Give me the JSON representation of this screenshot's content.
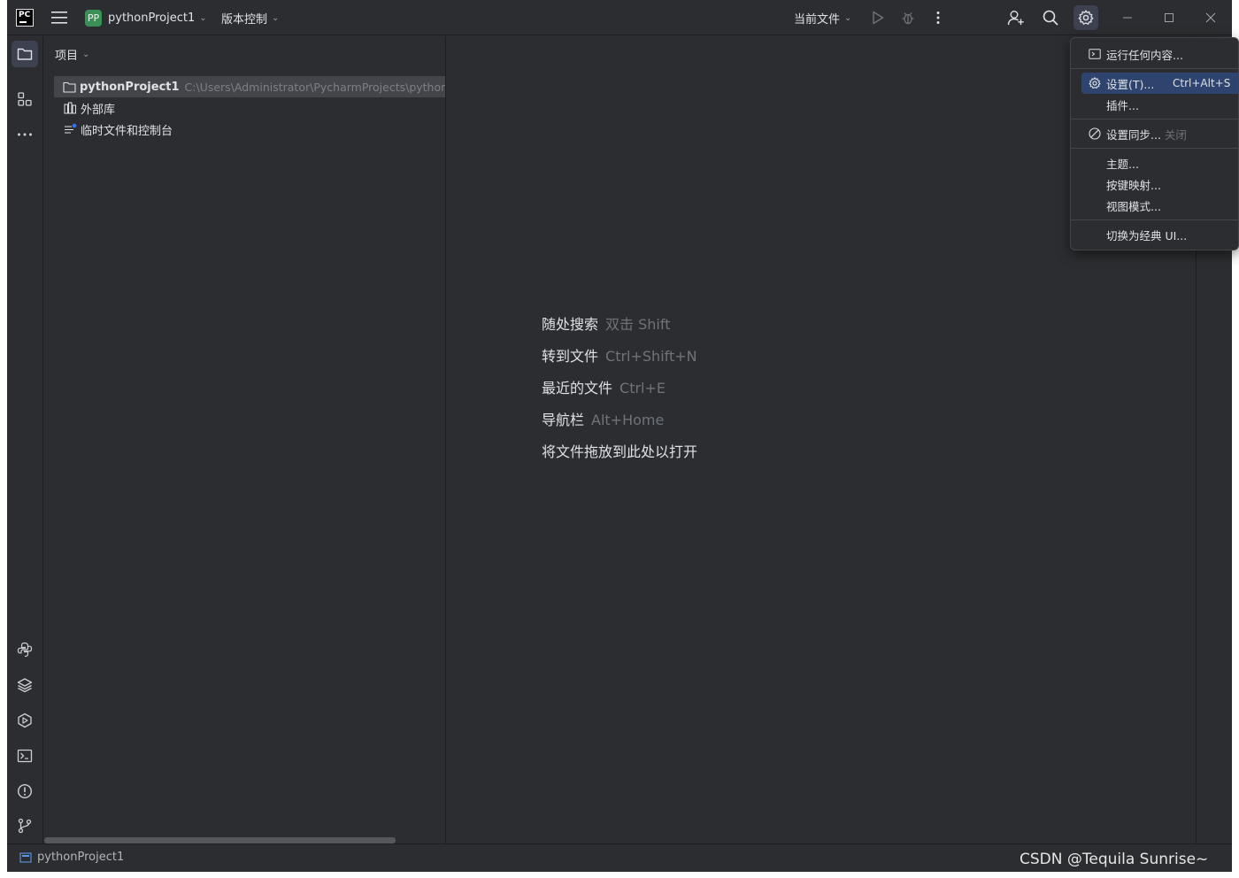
{
  "titlebar": {
    "logo": "PC",
    "project_badge": "PP",
    "project_name": "pythonProject1",
    "vcs_label": "版本控制",
    "run_config": "当前文件"
  },
  "project_panel": {
    "header": "项目",
    "tree": [
      {
        "label": "pythonProject1",
        "path": "C:\\Users\\Administrator\\PycharmProjects\\python",
        "icon": "folder-icon"
      },
      {
        "label": "外部库",
        "icon": "library-icon"
      },
      {
        "label": "临时文件和控制台",
        "icon": "scratch-icon"
      }
    ]
  },
  "editor_hints": [
    {
      "label": "随处搜索",
      "shortcut": "双击 Shift"
    },
    {
      "label": "转到文件",
      "shortcut": "Ctrl+Shift+N"
    },
    {
      "label": "最近的文件",
      "shortcut": "Ctrl+E"
    },
    {
      "label": "导航栏",
      "shortcut": "Alt+Home"
    },
    {
      "label": "将文件拖放到此处以打开",
      "shortcut": ""
    }
  ],
  "settings_menu": {
    "items": [
      {
        "label": "运行任何内容...",
        "icon": "run-anything-icon"
      },
      {
        "label": "设置(T)...",
        "shortcut": "Ctrl+Alt+S",
        "icon": "gear-icon",
        "highlighted": true
      },
      {
        "label": "插件..."
      },
      {
        "label": "设置同步...",
        "suffix": "关闭",
        "icon": "sync-off-icon"
      },
      {
        "label": "主题..."
      },
      {
        "label": "按键映射..."
      },
      {
        "label": "视图模式..."
      },
      {
        "label": "切换为经典 UI..."
      }
    ]
  },
  "statusbar": {
    "project": "pythonProject1"
  },
  "watermark": "CSDN @Tequila Sunrise~",
  "colors": {
    "bg": "#2b2d30",
    "highlight": "#2e436e",
    "badge": "#3d8f58",
    "text": "#dfe1e5",
    "muted": "#6f737a"
  }
}
